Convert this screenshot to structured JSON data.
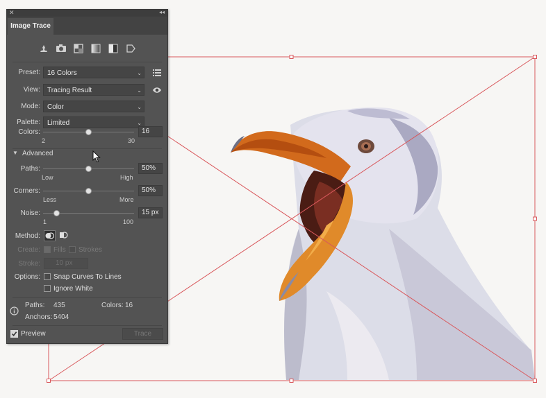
{
  "panel": {
    "title": "Image Trace",
    "presets_icons": [
      "auto-color-icon",
      "high-color-icon",
      "low-color-icon",
      "grayscale-icon",
      "black-and-white-icon",
      "outline-icon"
    ],
    "preset": {
      "label": "Preset:",
      "value": "16 Colors"
    },
    "view": {
      "label": "View:",
      "value": "Tracing Result"
    },
    "mode": {
      "label": "Mode:",
      "value": "Color"
    },
    "palette": {
      "label": "Palette:",
      "value": "Limited"
    },
    "colors": {
      "label": "Colors:",
      "value": "16",
      "min": "2",
      "max": "30",
      "level": 0.5
    },
    "advanced": {
      "label": "Advanced"
    },
    "paths": {
      "label": "Paths:",
      "value": "50%",
      "min": "Low",
      "max": "High",
      "level": 0.5
    },
    "corners": {
      "label": "Corners:",
      "value": "50%",
      "min": "Less",
      "max": "More",
      "level": 0.5
    },
    "noise": {
      "label": "Noise:",
      "value": "15 px",
      "min": "1",
      "max": "100",
      "level": 0.15
    },
    "method": {
      "label": "Method:"
    },
    "create": {
      "label": "Create:",
      "fills": "Fills",
      "strokes": "Strokes"
    },
    "stroke": {
      "label": "Stroke:",
      "value": "10 px"
    },
    "options": {
      "label": "Options:",
      "snap": "Snap Curves To Lines",
      "ignore_white": "Ignore White"
    },
    "stats": {
      "paths_label": "Paths:",
      "paths_value": "435",
      "colors_label": "Colors:",
      "colors_value": "16",
      "anchors_label": "Anchors:",
      "anchors_value": "5404"
    },
    "preview": {
      "label": "Preview",
      "checked": true
    },
    "trace_button": "Trace"
  },
  "colors": {
    "selection": "#d9585c",
    "panel_bg": "#535353"
  }
}
